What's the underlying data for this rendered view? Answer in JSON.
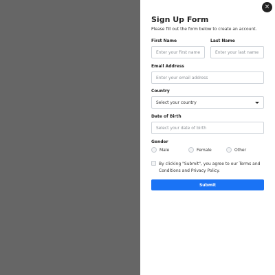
{
  "form": {
    "title": "Sign Up Form",
    "subtitle": "Please fill out the form below to create an account.",
    "first_name": {
      "label": "First Name",
      "placeholder": "Enter your first name"
    },
    "last_name": {
      "label": "Last Name",
      "placeholder": "Enter your last name"
    },
    "email": {
      "label": "Email Address",
      "placeholder": "Enter your email address"
    },
    "country": {
      "label": "Country",
      "selected": "Select your country"
    },
    "dob": {
      "label": "Date of Birth",
      "placeholder": "Select your date of birth"
    },
    "gender": {
      "label": "Gender",
      "options": [
        "Male",
        "Female",
        "Other"
      ]
    },
    "terms_text": "By clicking \"Submit\", you agree to our Terms and Conditions and Privacy Policy.",
    "submit_label": "Submit"
  },
  "close_icon": "×",
  "colors": {
    "overlay": "#666666",
    "primary": "#1a73f5"
  }
}
